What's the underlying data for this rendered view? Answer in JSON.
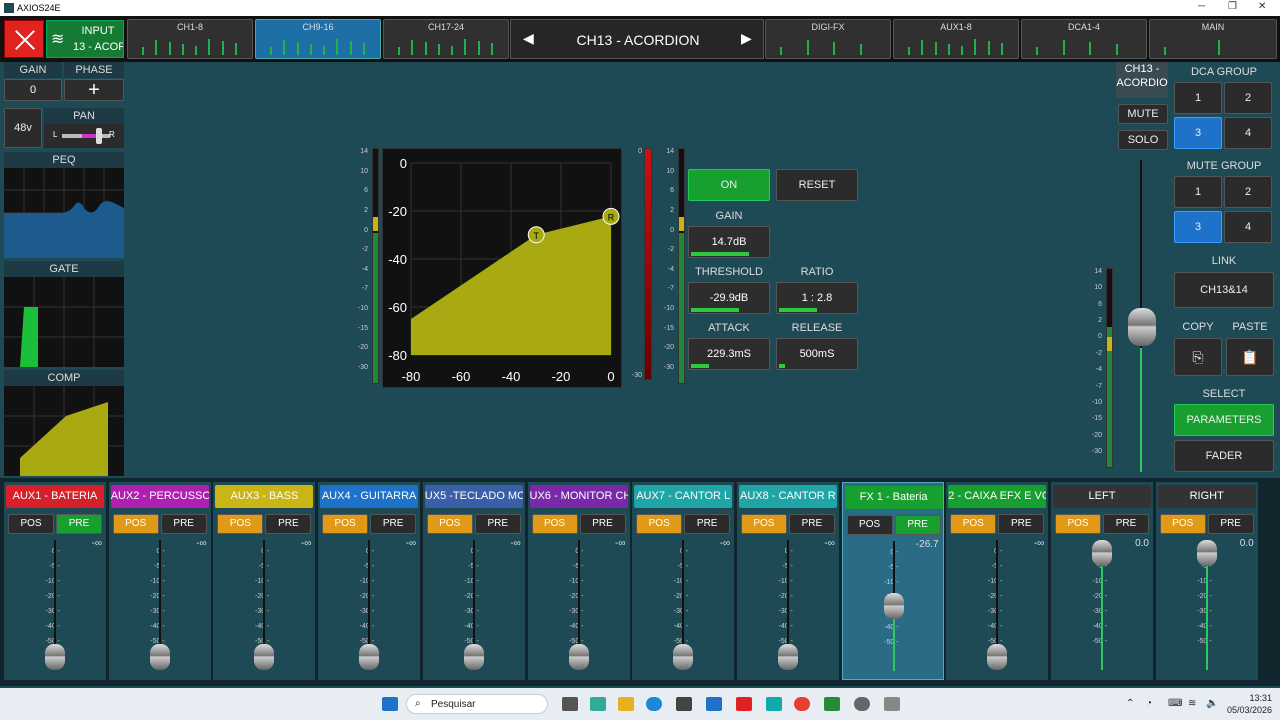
{
  "window": {
    "title": "AXIOS24E",
    "min": "─",
    "max": "❐",
    "close": "✕"
  },
  "top": {
    "input_l1": "INPUT",
    "input_l2": "13 - ACORD",
    "wifi": "wifi-icon",
    "banks": [
      "CH1-8",
      "CH9-16",
      "CH17-24",
      "DIGI-FX",
      "AUX1-8",
      "DCA1-4",
      "MAIN"
    ],
    "channel_name": "CH13 - ACORDION",
    "prev": "◀",
    "next": "▶"
  },
  "left": {
    "gain_label": "GAIN",
    "phase_label": "PHASE",
    "gain_value": "0",
    "phase_value": "+",
    "p48": "48v",
    "pan_label": "PAN",
    "pan_l": "L",
    "pan_r": "R",
    "peq": "PEQ",
    "gate": "GATE",
    "comp": "COMP"
  },
  "comp": {
    "on": "ON",
    "reset": "RESET",
    "gain_label": "GAIN",
    "gain_value": "14.7dB",
    "threshold_label": "THRESHOLD",
    "threshold_value": "-29.9dB",
    "ratio_label": "RATIO",
    "ratio_value": "1 : 2.8",
    "attack_label": "ATTACK",
    "attack_value": "229.3mS",
    "release_label": "RELEASE",
    "release_value": "500mS",
    "y_ticks": [
      "0",
      "-20",
      "-40",
      "-60",
      "-80"
    ],
    "x_ticks": [
      "-80",
      "-60",
      "-40",
      "-20",
      "0"
    ],
    "t_marker": "T",
    "r_marker": "R",
    "in_meter_scale": [
      "14",
      "10",
      "6",
      "2",
      "0",
      "-2",
      "-4",
      "-7",
      "-10",
      "-15",
      "-20",
      "-30"
    ],
    "gr_scale": [
      "0",
      "-30"
    ],
    "out_scale": [
      "14",
      "10",
      "6",
      "2",
      "0",
      "-2",
      "-4",
      "-7",
      "-10",
      "-15",
      "-20",
      "-30"
    ]
  },
  "right": {
    "ch_name": "CH13 - ACORDIO",
    "ch_name_more": "N",
    "mute": "MUTE",
    "solo": "SOLO",
    "dca_group": "DCA GROUP",
    "dca": [
      "1",
      "2",
      "3",
      "4"
    ],
    "mute_group": "MUTE GROUP",
    "mg": [
      "1",
      "2",
      "3",
      "4"
    ],
    "link": "LINK",
    "link_value": "CH13&14",
    "copy": "COPY",
    "paste": "PASTE",
    "select": "SELECT",
    "parameters": "PARAMETERS",
    "fader": "FADER",
    "meter_scale": [
      "14",
      "10",
      "6",
      "2",
      "0",
      "-2",
      "-4",
      "-7",
      "-10",
      "-15",
      "-20",
      "-30"
    ]
  },
  "strips": [
    {
      "name": "AUX1 - BATERIA",
      "color": "#d8202a",
      "pos": "POS",
      "pre": "PRE",
      "active": "pre",
      "db": "-∞",
      "level": 0
    },
    {
      "name": "AUX2 - PERCUSSO",
      "color": "#b020b0",
      "pos": "POS",
      "pre": "PRE",
      "active": "pos",
      "db": "-∞",
      "level": 0
    },
    {
      "name": "AUX3 - BASS",
      "color": "#c9b515",
      "pos": "POS",
      "pre": "PRE",
      "active": "pos",
      "db": "-∞",
      "level": 0
    },
    {
      "name": "AUX4 - GUITARRA",
      "color": "#1e72c9",
      "pos": "POS",
      "pre": "PRE",
      "active": "pos",
      "db": "-∞",
      "level": 0
    },
    {
      "name": "UX5 -TECLADO MON",
      "color": "#3b5ea8",
      "pos": "POS",
      "pre": "PRE",
      "active": "pos",
      "db": "-∞",
      "level": 0
    },
    {
      "name": "UX6 - MONITOR CH",
      "color": "#7a2aa8",
      "pos": "POS",
      "pre": "PRE",
      "active": "pos",
      "db": "-∞",
      "level": 0
    },
    {
      "name": "AUX7 - CANTOR L",
      "color": "#1fa5a5",
      "pos": "POS",
      "pre": "PRE",
      "active": "pos",
      "db": "-∞",
      "level": 0
    },
    {
      "name": "AUX8 - CANTOR R",
      "color": "#1fa5a5",
      "pos": "POS",
      "pre": "PRE",
      "active": "pos",
      "db": "-∞",
      "level": 0
    },
    {
      "name": "FX 1 - Bateria",
      "color": "#17a02f",
      "pos": "POS",
      "pre": "PRE",
      "active": "pre",
      "db": "-26.7",
      "level": 0.4
    },
    {
      "name": "2 - CAIXA EFX E VOC",
      "color": "#17a02f",
      "pos": "POS",
      "pre": "PRE",
      "active": "pos",
      "db": "-∞",
      "level": 0
    },
    {
      "name": "LEFT",
      "color": "#333333",
      "pos": "POS",
      "pre": "PRE",
      "active": "pos",
      "db": "0.0",
      "level": 1
    },
    {
      "name": "RIGHT",
      "color": "#333333",
      "pos": "POS",
      "pre": "PRE",
      "active": "pos",
      "db": "0.0",
      "level": 1
    }
  ],
  "fader_scale": [
    "0 -",
    "-5 -",
    "-10 -",
    "-20 -",
    "-30 -",
    "-40 -",
    "-50 -",
    "-∞ -"
  ],
  "taskbar": {
    "search": "Pesquisar",
    "time": "13:31",
    "date": "05/03/2026"
  }
}
